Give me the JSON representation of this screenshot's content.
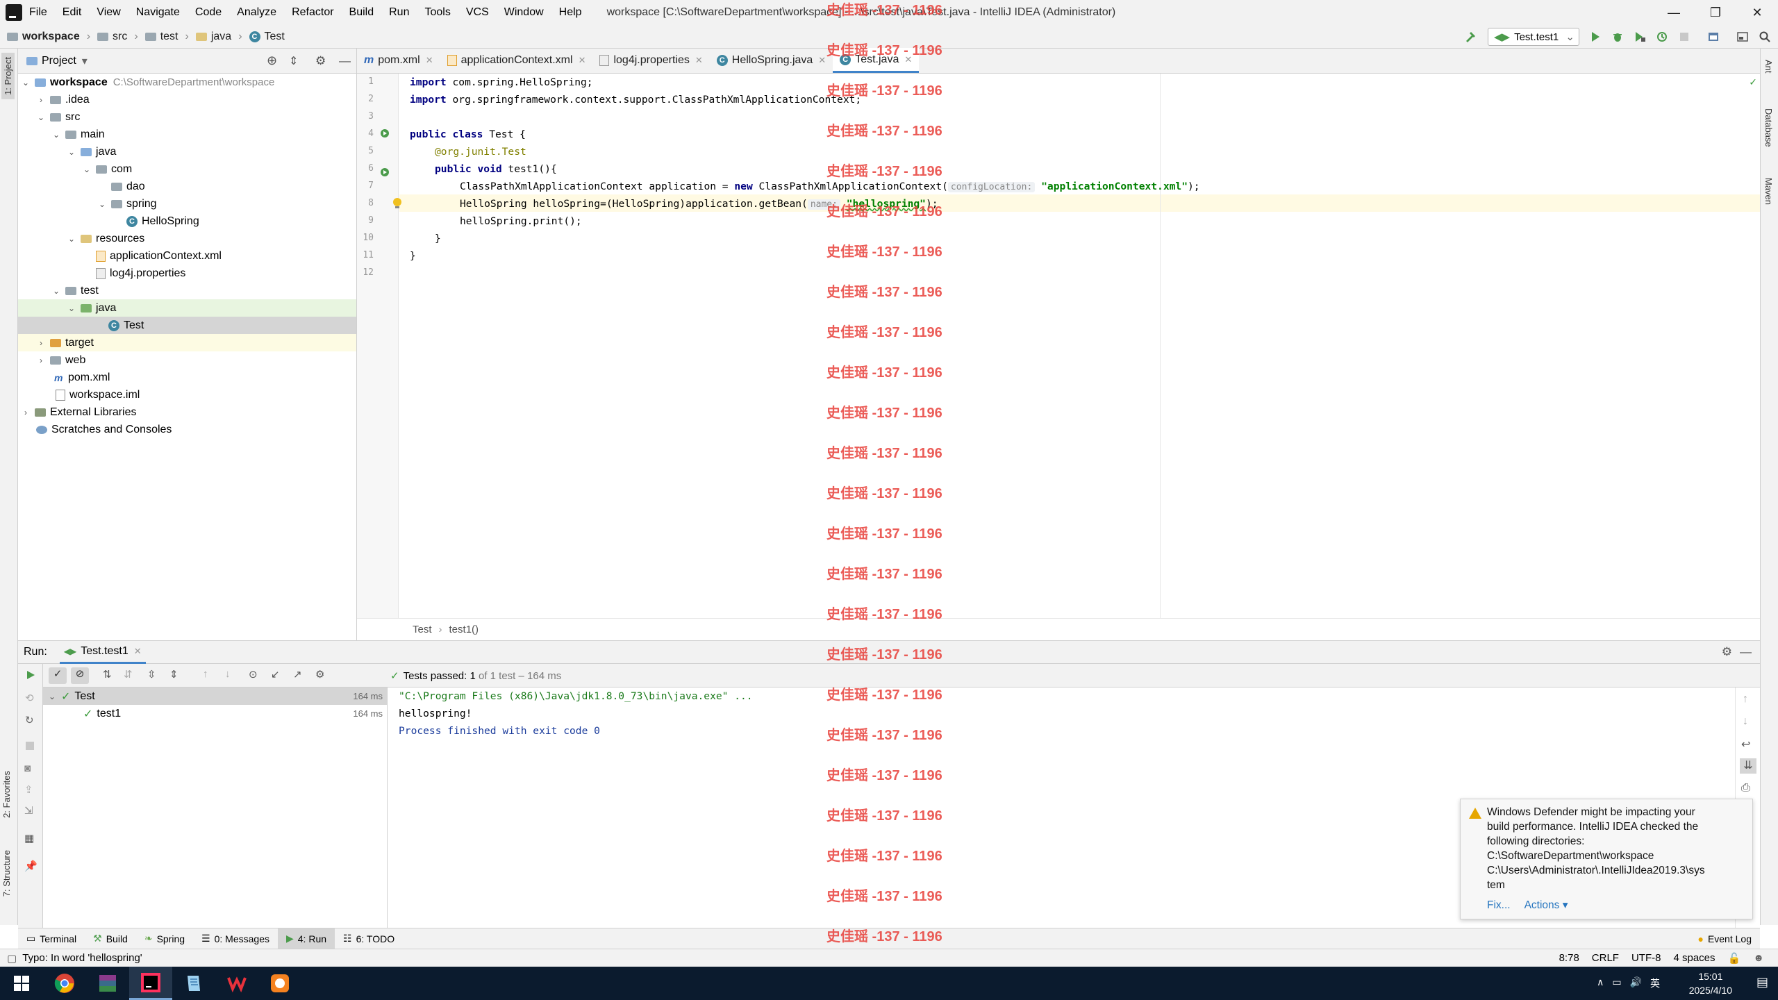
{
  "window": {
    "title": "workspace [C:\\SoftwareDepartment\\workspace] - ...\\src\\test\\java\\Test.java - IntelliJ IDEA (Administrator)",
    "menu": [
      "File",
      "Edit",
      "View",
      "Navigate",
      "Code",
      "Analyze",
      "Refactor",
      "Build",
      "Run",
      "Tools",
      "VCS",
      "Window",
      "Help"
    ]
  },
  "breadcrumb": [
    "workspace",
    "src",
    "test",
    "java",
    "Test"
  ],
  "run_config": "Test.test1",
  "project_panel": {
    "title": "Project",
    "tree": [
      {
        "label": "workspace",
        "path": "C:\\SoftwareDepartment\\workspace"
      },
      {
        "label": ".idea"
      },
      {
        "label": "src"
      },
      {
        "label": "main"
      },
      {
        "label": "java"
      },
      {
        "label": "com"
      },
      {
        "label": "dao"
      },
      {
        "label": "spring"
      },
      {
        "label": "HelloSpring"
      },
      {
        "label": "resources"
      },
      {
        "label": "applicationContext.xml"
      },
      {
        "label": "log4j.properties"
      },
      {
        "label": "test"
      },
      {
        "label": "java"
      },
      {
        "label": "Test"
      },
      {
        "label": "target"
      },
      {
        "label": "web"
      },
      {
        "label": "pom.xml"
      },
      {
        "label": "workspace.iml"
      },
      {
        "label": "External Libraries"
      },
      {
        "label": "Scratches and Consoles"
      }
    ]
  },
  "editor_tabs": [
    "pom.xml",
    "applicationContext.xml",
    "log4j.properties",
    "HelloSpring.java",
    "Test.java"
  ],
  "code": {
    "line_numbers": [
      "1",
      "2",
      "3",
      "4",
      "5",
      "6",
      "7",
      "8",
      "9",
      "10",
      "11",
      "12"
    ],
    "l1_kw": "import",
    "l1_rest": " com.spring.HelloSpring;",
    "l2_kw": "import",
    "l2_rest": " org.springframework.context.support.ClassPathXmlApplicationContext;",
    "l4_kw1": "public class",
    "l4_rest": " Test {",
    "l5": "@org.junit.Test",
    "l6_kw": "public void",
    "l6_rest": " test1(){",
    "l7_a": "ClassPathXmlApplicationContext application = ",
    "l7_kw": "new",
    "l7_b": " ClassPathXmlApplicationContext(",
    "l7_hint": "configLocation:",
    "l7_str": "\"applicationContext.xml\"",
    "l7_end": ");",
    "l8_a": "HelloSpring helloSpring=(HelloSpring)application.getBean(",
    "l8_hint": "name:",
    "l8_str": "\"hellospring\"",
    "l8_end": ");",
    "l9": "helloSpring.print();",
    "l10": "}",
    "l11": "}"
  },
  "editor_breadcrumb": [
    "Test",
    "test1()"
  ],
  "run_panel": {
    "label": "Run:",
    "tab": "Test.test1",
    "tests_passed_bold": "Tests passed: 1",
    "tests_passed_rest": " of 1 test – 164 ms",
    "tree": [
      {
        "label": "Test",
        "time": "164 ms"
      },
      {
        "label": "test1",
        "time": "164 ms"
      }
    ],
    "console": [
      "\"C:\\Program Files (x86)\\Java\\jdk1.8.0_73\\bin\\java.exe\" ...",
      "hellospring!",
      "Process finished with exit code 0"
    ]
  },
  "notification": {
    "text_lines": [
      "Windows Defender might be impacting your",
      "build performance. IntelliJ IDEA checked the",
      "following directories:",
      "C:\\SoftwareDepartment\\workspace",
      "C:\\Users\\Administrator\\.IntelliJIdea2019.3\\sys",
      "tem"
    ],
    "fix": "Fix...",
    "actions": "Actions ▾"
  },
  "bottom_tabs": [
    "Terminal",
    "Build",
    "Spring",
    "0: Messages",
    "4: Run",
    "6: TODO"
  ],
  "event_log": "Event Log",
  "left_stripe": [
    "1: Project",
    "2: Favorites",
    "7: Structure"
  ],
  "right_stripe": [
    "Ant",
    "Database",
    "Maven"
  ],
  "status": {
    "message": "Typo: In word 'hellospring'",
    "position": "8:78",
    "line_sep": "CRLF",
    "encoding": "UTF-8",
    "indent": "4 spaces"
  },
  "taskbar": {
    "time": "15:01",
    "date": "2025/4/10",
    "ime": "英"
  },
  "watermark": "史佳瑶 -137 - 1196",
  "colors": {
    "accent": "#4083c9",
    "pass": "#3b9b3b",
    "watermark": "#e8403a",
    "taskbar": "#0b1b2e"
  }
}
